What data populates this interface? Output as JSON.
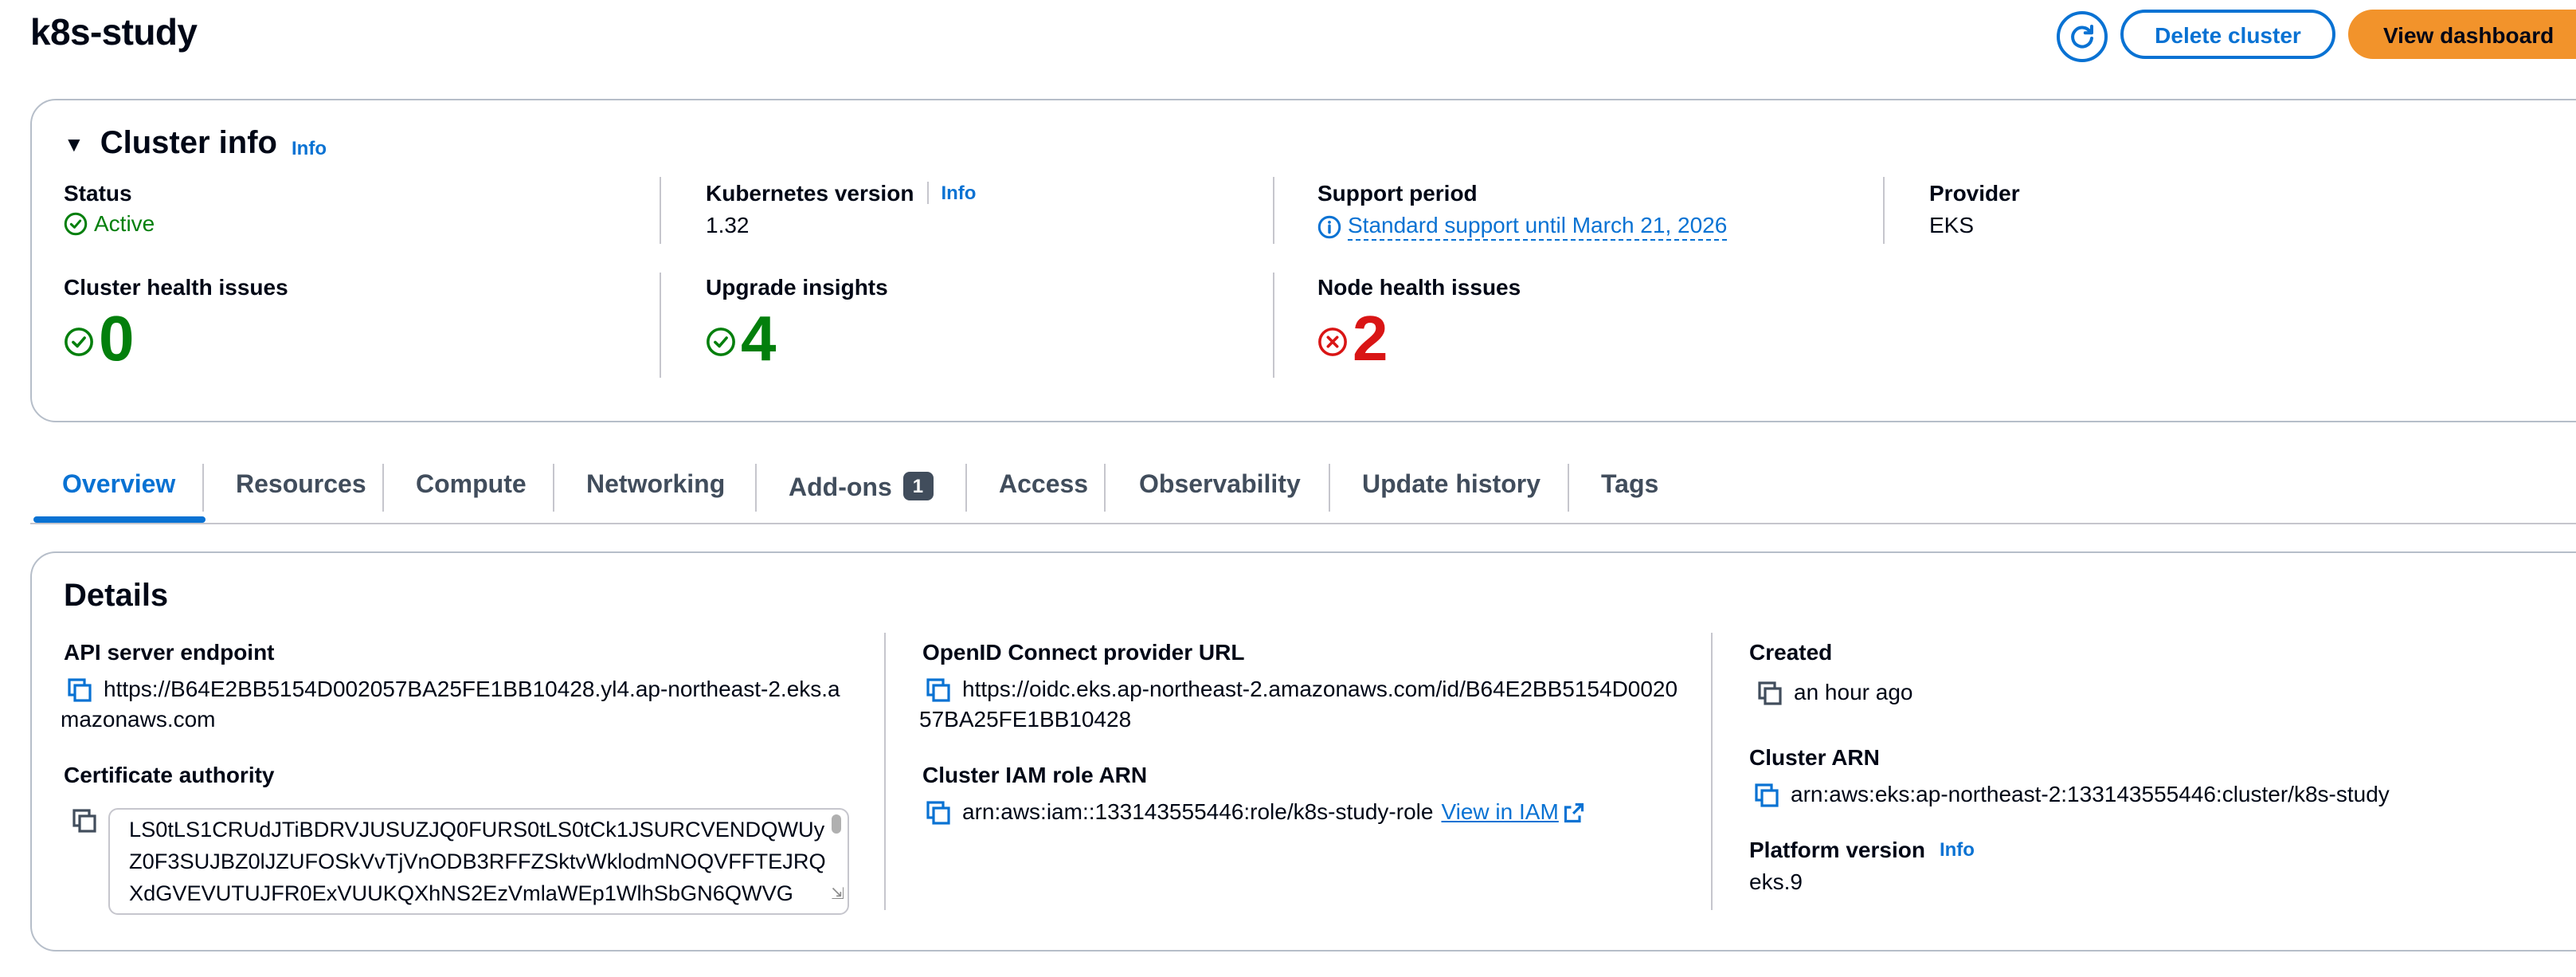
{
  "header": {
    "title": "k8s-study",
    "refresh_icon": "refresh-icon",
    "delete_label": "Delete cluster",
    "dashboard_label": "View dashboard"
  },
  "cluster_info": {
    "heading": "Cluster info",
    "info_link": "Info",
    "status_label": "Status",
    "status_value": "Active",
    "k8s_label": "Kubernetes version",
    "k8s_info": "Info",
    "k8s_value": "1.32",
    "support_label": "Support period",
    "support_value": "Standard support until March 21, 2026",
    "provider_label": "Provider",
    "provider_value": "EKS",
    "health_label": "Cluster health issues",
    "health_value": "0",
    "upgrade_label": "Upgrade insights",
    "upgrade_value": "4",
    "node_label": "Node health issues",
    "node_value": "2",
    "colors": {
      "success": "#037f0c",
      "error": "#d91515",
      "link": "#0972d3"
    }
  },
  "tabs": [
    {
      "label": "Overview",
      "active": true
    },
    {
      "label": "Resources"
    },
    {
      "label": "Compute"
    },
    {
      "label": "Networking"
    },
    {
      "label": "Add-ons",
      "badge": "1"
    },
    {
      "label": "Access"
    },
    {
      "label": "Observability"
    },
    {
      "label": "Update history"
    },
    {
      "label": "Tags"
    }
  ],
  "details": {
    "heading": "Details",
    "api_label": "API server endpoint",
    "api_value": "https://B64E2BB5154D002057BA25FE1BB10428.yl4.ap-northeast-2.eks.amazonaws.com",
    "cert_label": "Certificate authority",
    "cert_value": "LS0tLS1CRUdJTiBDRVJUSUZJQ0FURS0tLS0tCk1JSURCVENDQWUyZ0F3SUJBZ0lJZUFOSkVvTjVnODB3RFFZSktvWklodmNOQVFFTEJRQXdGVEVUTUJFR0ExVUUKQXhNS2EzVmlaWEp1WlhSbGN6QWVG",
    "oidc_label": "OpenID Connect provider URL",
    "oidc_value": "https://oidc.eks.ap-northeast-2.amazonaws.com/id/B64E2BB5154D002057BA25FE1BB10428",
    "iam_label": "Cluster IAM role ARN",
    "iam_value": "arn:aws:iam::133143555446:role/k8s-study-role",
    "iam_link": "View in IAM",
    "created_label": "Created",
    "created_value": "an hour ago",
    "arn_label": "Cluster ARN",
    "arn_value": "arn:aws:eks:ap-northeast-2:133143555446:cluster/k8s-study",
    "platform_label": "Platform version",
    "platform_info": "Info",
    "platform_value": "eks.9"
  }
}
